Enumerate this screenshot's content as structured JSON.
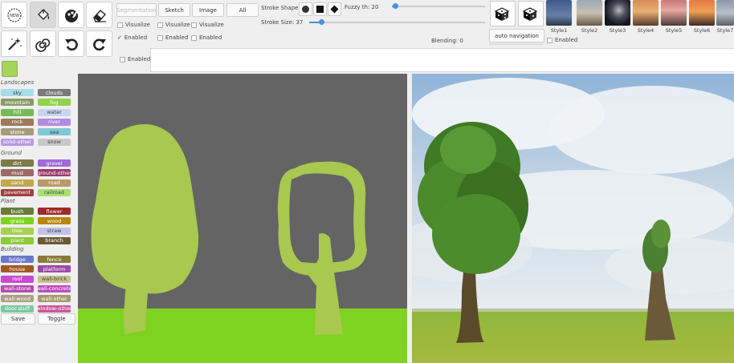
{
  "toolbar": {
    "row1_tools": [
      {
        "name": "new-icon",
        "label": "NEW"
      },
      {
        "name": "paint-bucket-icon"
      },
      {
        "name": "brush-icon"
      },
      {
        "name": "eraser-icon"
      }
    ],
    "row2_tools": [
      {
        "name": "magic-wand-icon"
      },
      {
        "name": "swirl-icon"
      },
      {
        "name": "undo-icon"
      },
      {
        "name": "redo-icon"
      }
    ]
  },
  "view_buttons": {
    "segmentation": "Segmentation",
    "sketch": "Sketch",
    "image": "Image",
    "all": "All"
  },
  "checkboxes": {
    "visualize_1": "Visualize",
    "visualize_2": "Visualize",
    "visualize_3": "Visualize",
    "enabled_1": "Enabled",
    "enabled_2": "Enabled",
    "enabled_3": "Enabled",
    "enabled_bottom": "Enabled",
    "enabled_style": "Enabled",
    "checked_mark": "✓"
  },
  "stroke": {
    "shape_label": "Stroke Shape",
    "size_label": "Stroke Size: 37",
    "size_value": 37,
    "fuzzy_label": "Fuzzy th: 20",
    "fuzzy_value": 20,
    "blending_label": "Blending: 0",
    "blending_value": 0
  },
  "auto_navigation": "auto navigation",
  "styles": [
    "Style1",
    "Style2",
    "Style3",
    "Style4",
    "Style5",
    "Style6",
    "Style7"
  ],
  "palette": {
    "sections": [
      "Landscapes",
      "Ground",
      "Plant",
      "Building"
    ],
    "landscapes": [
      {
        "label": "sky",
        "color": "#a8dde8"
      },
      {
        "label": "clouds",
        "color": "#7a7a7a"
      },
      {
        "label": "mountain",
        "color": "#8a9a6a"
      },
      {
        "label": "fog",
        "color": "#8fd44a"
      },
      {
        "label": "hill",
        "color": "#77bb55"
      },
      {
        "label": "water",
        "color": "#c7d4f2"
      },
      {
        "label": "rock",
        "color": "#9c7a5a"
      },
      {
        "label": "river",
        "color": "#b28ae0"
      },
      {
        "label": "stone",
        "color": "#a59b7c"
      },
      {
        "label": "sea",
        "color": "#7fc8d6"
      },
      {
        "label": "solid-other",
        "color": "#b79ae2"
      },
      {
        "label": "snow",
        "color": "#c8c8c8"
      }
    ],
    "ground": [
      {
        "label": "dirt",
        "color": "#7c7c4a"
      },
      {
        "label": "gravel",
        "color": "#a06ad8"
      },
      {
        "label": "mud",
        "color": "#9a6a6a"
      },
      {
        "label": "ground-other",
        "color": "#9b3c6c"
      },
      {
        "label": "sand",
        "color": "#c2a850"
      },
      {
        "label": "road",
        "color": "#bb9966"
      },
      {
        "label": "pavement",
        "color": "#a04040"
      },
      {
        "label": "railroad",
        "color": "#a8e070"
      }
    ],
    "plant": [
      {
        "label": "bush",
        "color": "#6a7a3a"
      },
      {
        "label": "flower",
        "color": "#a02828"
      },
      {
        "label": "grass",
        "color": "#7ed321"
      },
      {
        "label": "wood",
        "color": "#b8860b"
      },
      {
        "label": "tree",
        "color": "#a8d050"
      },
      {
        "label": "straw",
        "color": "#c2c2e8"
      },
      {
        "label": "plant",
        "color": "#8ccc38"
      },
      {
        "label": "branch",
        "color": "#6a5a3a"
      }
    ],
    "building": [
      {
        "label": "bridge",
        "color": "#6a7ac8"
      },
      {
        "label": "fence",
        "color": "#8a7a3a"
      },
      {
        "label": "house",
        "color": "#a05a28"
      },
      {
        "label": "platform",
        "color": "#9c4aa8"
      },
      {
        "label": "roof",
        "color": "#c84ad0"
      },
      {
        "label": "wall-brick",
        "color": "#c8c090"
      },
      {
        "label": "wall-stone",
        "color": "#b84ab0"
      },
      {
        "label": "wall-concrete",
        "color": "#c04cc0"
      },
      {
        "label": "wall-wood",
        "color": "#a8a080"
      },
      {
        "label": "wall-other",
        "color": "#a89870"
      },
      {
        "label": "door-stuff",
        "color": "#7cc8a0"
      },
      {
        "label": "window-other",
        "color": "#c85a9a"
      }
    ]
  },
  "bottom_buttons": {
    "save": "Save",
    "toggle": "Toggle"
  },
  "colors": {
    "selected_swatch": "#a5d65a",
    "canvas_bg": "#646464",
    "canvas_ground": "#7ed321",
    "sketch_tree": "#a8c850",
    "accent": "#4a90d9"
  }
}
